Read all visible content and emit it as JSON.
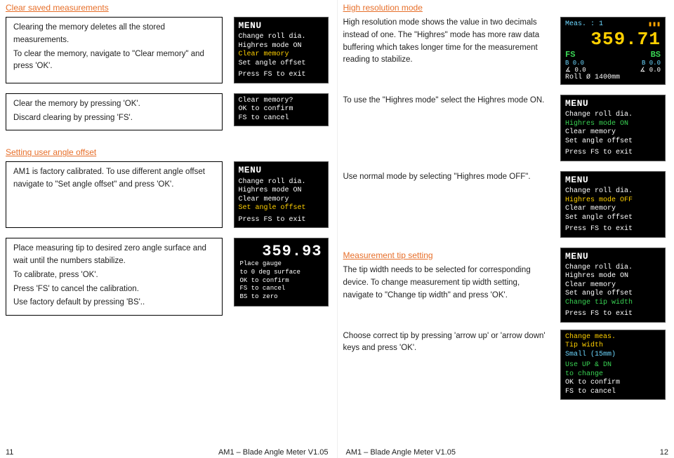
{
  "left_page": {
    "sections": {
      "clear_saved": {
        "heading": "Clear saved measurements",
        "block1": {
          "p1": "Clearing the memory deletes all the stored measurements.",
          "p2": "To clear the memory, navigate to \"Clear memory\" and press 'OK'."
        },
        "block2": {
          "p1": "Clear the memory by pressing 'OK'.",
          "p2": "Discard clearing by pressing 'FS'."
        },
        "menu1": {
          "title": "MENU",
          "l1": "Change roll dia.",
          "l2": "Highres mode ON",
          "l3": "Clear memory",
          "l4": "Set angle offset",
          "foot": "Press FS to exit"
        },
        "confirm": {
          "l1": "Clear memory?",
          "l2": "OK to confirm",
          "l3": "FS to cancel"
        }
      },
      "angle_offset": {
        "heading": "Setting user angle offset",
        "block1": {
          "p1": "AM1 is factory calibrated. To use different angle offset navigate to  \"Set angle offset\" and press 'OK'."
        },
        "menu": {
          "title": "MENU",
          "l1": "Change roll dia.",
          "l2": "Highres mode ON",
          "l3": "Clear memory",
          "l4": "Set angle offset",
          "foot": "Press FS to exit"
        },
        "block2": {
          "p1": "Place measuring tip to desired zero angle surface and wait until the numbers stabilize.",
          "p2": "To calibrate, press 'OK'.",
          "p3": "Press  'FS' to cancel the calibration.",
          "p4": "Use factory default by  pressing  'BS'.."
        },
        "calib": {
          "val": "359.93",
          "l1": "Place gauge",
          "l2": "to 0 deg surface",
          "l3": "OK to confirm",
          "l4": "FS to cancel",
          "l5": "BS to zero"
        }
      }
    },
    "footer": {
      "page_no": "11",
      "doc": "AM1 – Blade Angle Meter V1.05"
    }
  },
  "right_page": {
    "sections": {
      "highres": {
        "heading": "High resolution mode",
        "block1": {
          "p1": "High resolution mode shows the value in two decimals instead of one. The \"Highres\" mode has more raw data buffering which takes longer time for the measurement reading to stabilize."
        },
        "block2": {
          "p1": "To use the \"Highres mode\" select the Highres mode ON."
        },
        "block3": {
          "p1": "Use normal mode by selecting \"Highres mode OFF\"."
        },
        "meas": {
          "top_l": "Meas. : 1",
          "big": "359.71",
          "fs": "FS",
          "bs": "BS",
          "r3a": "B   0.0",
          "r3b": "B   0.0",
          "r4a": "∡   0.0",
          "r4b": "∡   0.0",
          "foot": "Roll Ø 1400mm"
        },
        "menu_on": {
          "title": "MENU",
          "l1": "Change roll dia.",
          "l2": "Highres mode ON",
          "l3": "Clear memory",
          "l4": "Set angle offset",
          "foot": "Press FS to exit"
        },
        "menu_off": {
          "title": "MENU",
          "l1": "Change roll dia.",
          "l2": "Highres mode OFF",
          "l3": "Clear memory",
          "l4": "Set angle offset",
          "foot": "Press FS to exit"
        }
      },
      "tip": {
        "heading": "Measurement tip setting",
        "block1": {
          "p1": "The tip width needs to be selected for corresponding device. To change measurement tip width setting, navigate to \"Change tip width\" and press 'OK'."
        },
        "block2": {
          "p1": "Choose correct tip by pressing 'arrow up' or 'arrow down' keys and press 'OK'."
        },
        "menu_tip": {
          "title": "MENU",
          "l1": "Change roll dia.",
          "l2": "Highres mode ON",
          "l3": "Clear memory",
          "l4": "Set angle offset",
          "l5": "Change tip width",
          "foot": "Press FS to exit"
        },
        "tip_select": {
          "l1": "Change meas.",
          "l2": "Tip width",
          "l3": "Small (15mm)",
          "l4": "Use UP & DN",
          "l5": "to change",
          "l6": "OK to confirm",
          "l7": "FS to cancel"
        }
      }
    },
    "footer": {
      "doc": "AM1 – Blade Angle Meter V1.05",
      "page_no": "12"
    }
  }
}
